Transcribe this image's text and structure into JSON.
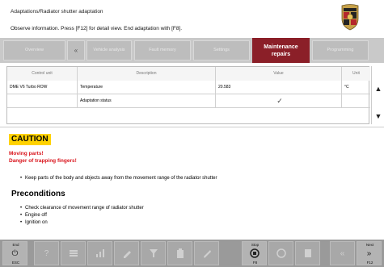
{
  "header": {
    "title": "Adaptations/Radiator shutter adaptation",
    "instruction": "Observe information. Press [F12] for detail view. End adaptation with [F8]."
  },
  "tabs": [
    {
      "label": "Overview",
      "active": false
    },
    {
      "label": "«",
      "active": false
    },
    {
      "label": "Vehicle analysis",
      "active": false
    },
    {
      "label": "Fault memory",
      "active": false
    },
    {
      "label": "Settings",
      "active": false
    },
    {
      "label": "Maintenance repairs",
      "active": true
    },
    {
      "label": "Programming",
      "active": false
    }
  ],
  "table": {
    "columns": [
      "Control unit",
      "Description",
      "Value",
      "Unit"
    ],
    "rows": [
      {
        "control_unit": "DME V6 Turbo ROW",
        "description": "Temperature",
        "value": "20.583",
        "unit": "°C"
      },
      {
        "control_unit": "",
        "description": "Adaptation status",
        "value": "✓",
        "unit": ""
      }
    ]
  },
  "scroll": {
    "up": "▲",
    "down": "▼"
  },
  "info": {
    "caution": "CAUTION",
    "warning_line1": "Moving parts!",
    "warning_line2": "Danger of trapping fingers!",
    "warning_bullet": "Keep parts of the body and objects away from the movement range of the radiator shutter",
    "preconditions_title": "Preconditions",
    "preconditions": [
      "Check clearance of movement range of radiator shutter",
      "Engine off",
      "Ignition on"
    ]
  },
  "toolbar": {
    "end_label": "End",
    "end_key": "ESC",
    "end_icon": "⏻",
    "help_icon": "?",
    "stop_label": "Stop",
    "stop_key": "F8",
    "next_label": "Next",
    "next_key": "F12",
    "next_icon": "»",
    "back_icon": "«"
  }
}
